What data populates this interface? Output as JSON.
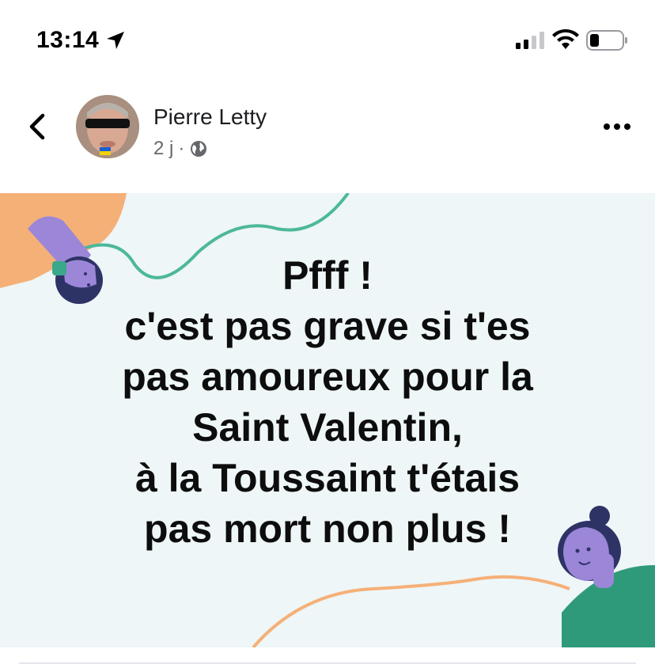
{
  "status_bar": {
    "time": "13:14"
  },
  "post": {
    "author": "Pierre Letty",
    "age": "2 j",
    "separator": "·",
    "privacy_icon": "globe-icon",
    "image_text": "Pfff !\nc'est pas grave si t'es\npas amoureux pour la\nSaint Valentin,\nà la Toussaint t'étais\npas mort  non plus !"
  },
  "colors": {
    "image_background": "#eef6f7",
    "accent_teal": "#4db89a",
    "accent_orange": "#f5b078",
    "accent_purple": "#9b86d8",
    "accent_navy": "#2e3366",
    "accent_green": "#2f9a7a"
  }
}
